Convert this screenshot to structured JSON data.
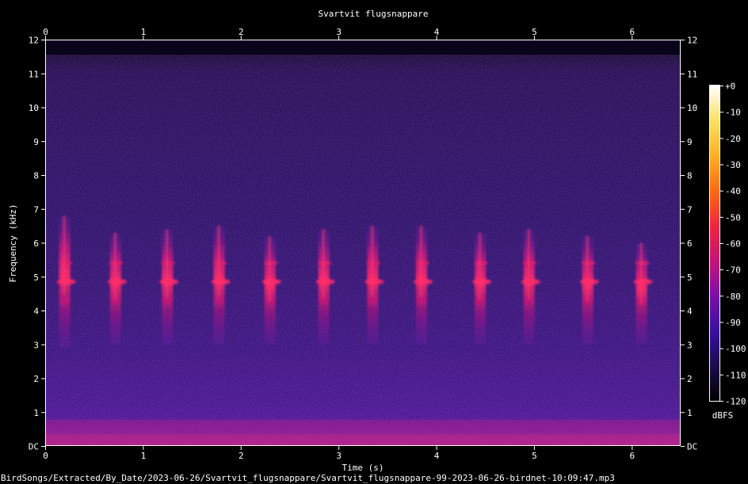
{
  "chart_data": {
    "type": "spectrogram",
    "title": "Svartvit flugsnappare",
    "xlabel": "Time (s)",
    "ylabel": "Frequency (kHz)",
    "xlim": [
      0,
      6.5
    ],
    "ylim": [
      0,
      12
    ],
    "x_ticks": [
      "0",
      "1",
      "2",
      "3",
      "4",
      "5",
      "6"
    ],
    "y_ticks": [
      "DC",
      "1",
      "2",
      "3",
      "4",
      "5",
      "6",
      "7",
      "8",
      "9",
      "10",
      "11",
      "12"
    ],
    "colorbar": {
      "label": "dBFS",
      "ticks": [
        "+0",
        "-10",
        "-20",
        "-30",
        "-40",
        "-50",
        "-60",
        "-70",
        "-80",
        "-90",
        "-100",
        "-110",
        "-120"
      ],
      "range": [
        -120,
        0
      ],
      "colors": [
        "#000000",
        "#1a0b4e",
        "#3b0fa0",
        "#7a0fa8",
        "#c8127a",
        "#f0253c",
        "#ff6a10",
        "#ffb020",
        "#ffe060",
        "#ffffff"
      ]
    },
    "syllables": [
      {
        "t": 0.2,
        "f_low": 2.9,
        "f_high": 6.8
      },
      {
        "t": 0.72,
        "f_low": 3.0,
        "f_high": 6.3
      },
      {
        "t": 1.25,
        "f_low": 3.0,
        "f_high": 6.4
      },
      {
        "t": 1.78,
        "f_low": 3.0,
        "f_high": 6.5
      },
      {
        "t": 2.3,
        "f_low": 3.0,
        "f_high": 6.2
      },
      {
        "t": 2.85,
        "f_low": 3.0,
        "f_high": 6.4
      },
      {
        "t": 3.35,
        "f_low": 3.0,
        "f_high": 6.5
      },
      {
        "t": 3.85,
        "f_low": 3.0,
        "f_high": 6.5
      },
      {
        "t": 4.45,
        "f_low": 3.0,
        "f_high": 6.3
      },
      {
        "t": 4.95,
        "f_low": 3.0,
        "f_high": 6.4
      },
      {
        "t": 5.55,
        "f_low": 3.0,
        "f_high": 6.2
      },
      {
        "t": 6.1,
        "f_low": 3.0,
        "f_high": 6.0
      }
    ]
  },
  "file_path": "BirdSongs/Extracted/By_Date/2023-06-26/Svartvit_flugsnappare/Svartvit_flugsnappare-99-2023-06-26-birdnet-10:09:47.mp3"
}
